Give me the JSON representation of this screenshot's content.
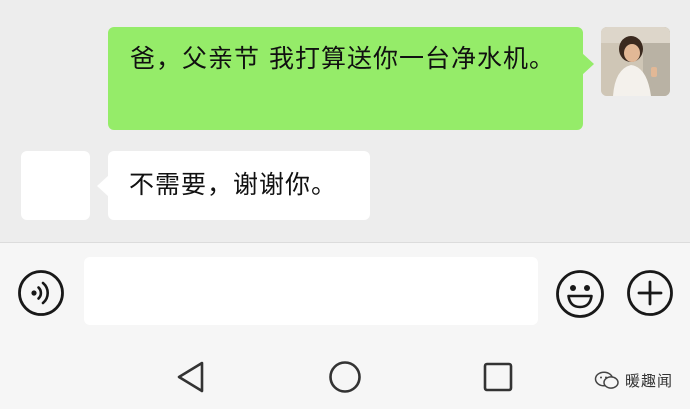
{
  "chat": {
    "messages": [
      {
        "sender": "me",
        "text": "爸，父亲节 我打算送你一台净水机。"
      },
      {
        "sender": "dad",
        "text": "不需要，谢谢你。"
      }
    ]
  },
  "input_bar": {
    "icons": {
      "voice": "voice-icon",
      "emoji": "emoji-icon",
      "plus": "plus-icon"
    },
    "input_value": ""
  },
  "nav_bar": {
    "icons": {
      "back": "triangle-back-icon",
      "home": "circle-home-icon",
      "recent": "square-recent-icon"
    }
  },
  "watermark": {
    "text": "暖趣闻"
  },
  "colors": {
    "background": "#ededed",
    "my_bubble": "#95ec69",
    "other_bubble": "#ffffff",
    "input_bar": "#f6f6f6",
    "icon_stroke": "#181818"
  }
}
